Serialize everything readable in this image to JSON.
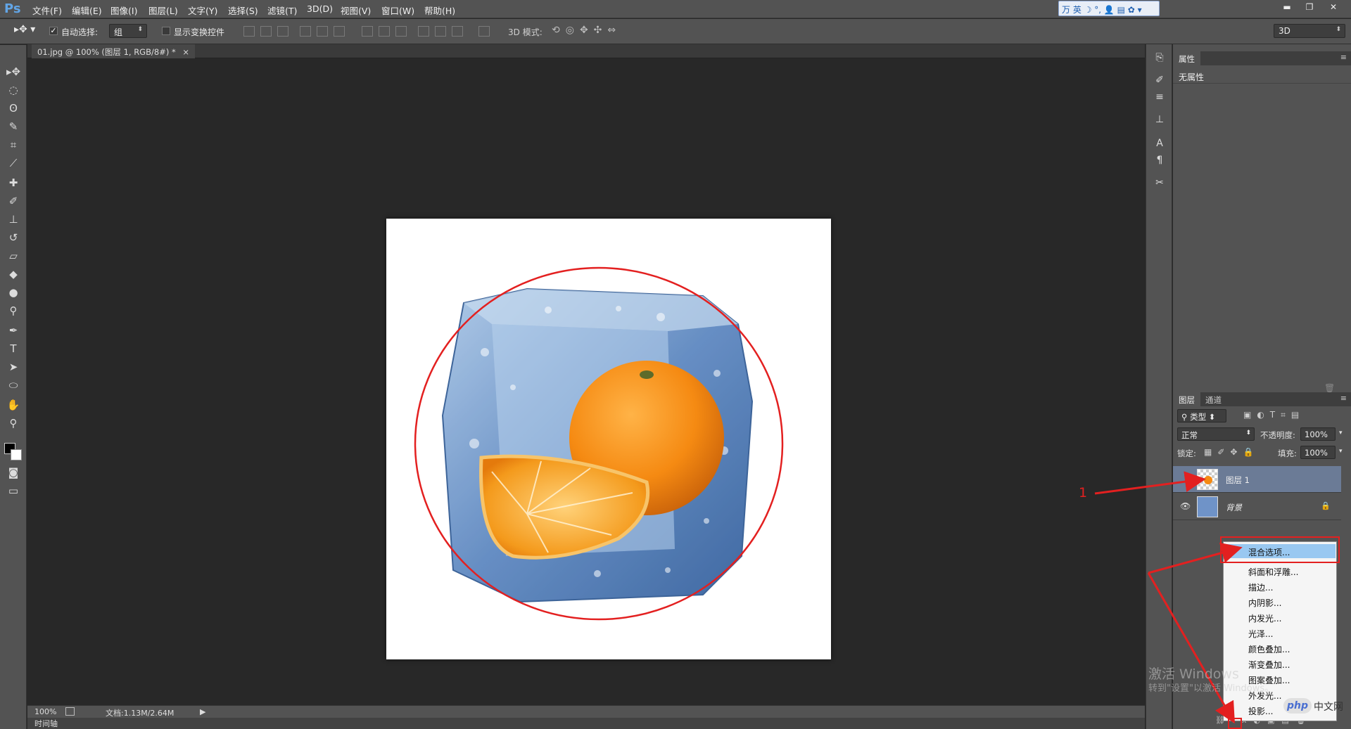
{
  "app": {
    "logo": "Ps"
  },
  "menu": [
    "文件(F)",
    "编辑(E)",
    "图像(I)",
    "图层(L)",
    "文字(Y)",
    "选择(S)",
    "滤镜(T)",
    "3D(D)",
    "视图(V)",
    "窗口(W)",
    "帮助(H)"
  ],
  "ime": {
    "label": "万 英 ☽ °, 👤 ▤ ✿ ▾"
  },
  "window_controls": {
    "minimize": "▬",
    "restore": "❐",
    "close": "✕"
  },
  "options": {
    "auto_select_label": "自动选择:",
    "auto_select_value": "组",
    "show_transform_label": "显示变换控件",
    "mode3d_label": "3D 模式:",
    "workspace_value": "3D"
  },
  "document": {
    "tab_title": "01.jpg @ 100% (图层 1, RGB/8#) *",
    "tab_close": "×"
  },
  "status": {
    "zoom": "100%",
    "doc_info": "文档:1.13M/2.64M",
    "arrow": "▶"
  },
  "timeline": {
    "label": "时间轴"
  },
  "properties": {
    "tab": "属性",
    "empty": "无属性"
  },
  "layers_panel": {
    "tabs": [
      "图层",
      "通道"
    ],
    "filter_kind": "类型",
    "blend_mode": "正常",
    "opacity_label": "不透明度:",
    "opacity_value": "100%",
    "lock_label": "锁定:",
    "fill_label": "填充:",
    "fill_value": "100%",
    "layers": [
      {
        "name": "图层 1",
        "selected": true,
        "visible": false
      },
      {
        "name": "背景",
        "selected": false,
        "visible": true,
        "locked": true
      }
    ]
  },
  "context_menu": {
    "items": [
      "混合选项...",
      "斜面和浮雕...",
      "描边...",
      "内阴影...",
      "内发光...",
      "光泽...",
      "颜色叠加...",
      "渐变叠加...",
      "图案叠加...",
      "外发光...",
      "投影..."
    ],
    "highlighted_index": 0
  },
  "annotation": {
    "label": "1",
    "color": "#e32020"
  },
  "watermark": {
    "line1": "激活 Windows",
    "line2": "转到\"设置\"以激活 Windows。"
  },
  "site_badge": {
    "logo": "php",
    "text": "中文网"
  },
  "colors": {
    "ui_bg": "#535353",
    "canvas_bg": "#282828",
    "accent_red": "#e32020",
    "menu_highlight": "#99c8f1"
  }
}
